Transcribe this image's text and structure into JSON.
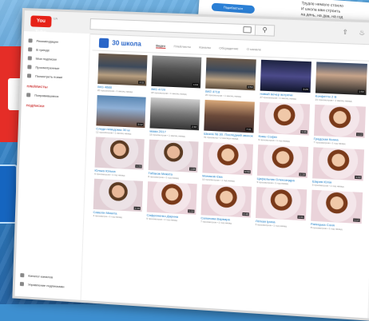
{
  "background_card": {
    "button_label": "Подобається",
    "text_lines": [
      "Трудов немало стоило",
      "И школа вам строить",
      "на день, на два, на год"
    ]
  },
  "colors": {
    "accent": "#e62117",
    "channel": "#2a66c8",
    "link": "#167ac6"
  },
  "topbar": {
    "logo_label": "You Tube",
    "country_code": "UA"
  },
  "sidebar": {
    "items": [
      {
        "icon": "home-icon",
        "label": "Рекомендации"
      },
      {
        "icon": "fire-icon",
        "label": "В тренде"
      },
      {
        "icon": "subscriptions-icon",
        "label": "Мои подписки"
      },
      {
        "icon": "history-icon",
        "label": "Просмотренные"
      },
      {
        "icon": "watch-later-icon",
        "label": "Посмотреть позже"
      }
    ],
    "section1_heading": "ПЛЕЙЛИСТЫ",
    "section1_items": [
      {
        "icon": "playlist-icon",
        "label": "Понравившиеся"
      }
    ],
    "section2_heading": "ПОДПИСКИ",
    "bottom_items": [
      {
        "icon": "catalog-icon",
        "label": "Каталог каналов"
      },
      {
        "icon": "manage-icon",
        "label": "Управление подписками"
      }
    ]
  },
  "channel": {
    "name": "30 школа",
    "tabs": [
      "Видео",
      "Плейлисты",
      "Каналы",
      "Обсуждение",
      "О канале"
    ],
    "active_tab": 0
  },
  "videos": [
    [
      {
        "thumb": "t-class",
        "title": "IMG 4688",
        "meta": "20 просмотров • 1 месяц назад",
        "duration": "2:11"
      },
      {
        "thumb": "t-dance",
        "title": "IMG 4720",
        "meta": "18 просмотров • 1 месяц назад",
        "duration": "1:04"
      },
      {
        "thumb": "t-class",
        "title": "IMG 4718",
        "meta": "20 просмотров • 1 месяц назад",
        "duration": "0:53"
      },
      {
        "thumb": "t-stage",
        "title": "новый вечер встречи",
        "meta": "27 просмотров • 1 месяц назад",
        "duration": "3:20"
      },
      {
        "thumb": "t-boy",
        "title": "Конфетти 2 В",
        "meta": "21 просмотров • 1 месяц назад",
        "duration": "1:59"
      }
    ],
    [
      {
        "thumb": "t-blue",
        "title": "Следи неведомы 30 ш",
        "meta": "12 просмотров • 1 месяц назад",
        "duration": "3:12"
      },
      {
        "thumb": "t-bw",
        "title": "мама 2017",
        "meta": "15 просмотров • 1 месяц назад",
        "duration": "2:40"
      },
      {
        "thumb": "t-warm",
        "title": "Школа № 30. Последний звонок 2016",
        "meta": "41 просмотр • 2 месяца назад",
        "duration": "7:31"
      },
      {
        "thumb": "t-girl",
        "title": "Кокш Софія",
        "meta": "9 просмотров • 1 год назад",
        "duration": "1:05"
      },
      {
        "thumb": "t-girl",
        "title": "Градская Ксана",
        "meta": "7 просмотров • 1 год назад",
        "duration": "1:12"
      }
    ],
    [
      {
        "thumb": "t-boy2",
        "title": "Юлька Юлька",
        "meta": "6 просмотров • 1 год назад",
        "duration": "1:20"
      },
      {
        "thumb": "t-boy2",
        "title": "Табаков Микита",
        "meta": "8 просмотров • 1 год назад",
        "duration": "1:08"
      },
      {
        "thumb": "t-girl",
        "title": "Монаков Єва",
        "meta": "10 просмотров • 1 год назад",
        "duration": "0:59"
      },
      {
        "thumb": "t-girl",
        "title": "Цифельник Олександра",
        "meta": "9 просмотров • 1 год назад",
        "duration": "1:15"
      },
      {
        "thumb": "t-girl",
        "title": "Шария Юлія",
        "meta": "5 просмотров • 1 год назад",
        "duration": "1:02"
      }
    ],
    [
      {
        "thumb": "t-boy2",
        "title": "Савелін Микита",
        "meta": "4 просмотра • 1 год назад",
        "duration": "1:10"
      },
      {
        "thumb": "t-girl",
        "title": "Сафроненко Дарина",
        "meta": "6 просмотров • 1 год назад",
        "duration": "1:22"
      },
      {
        "thumb": "t-girl",
        "title": "Сапонова Варвара",
        "meta": "7 просмотров • 1 год назад",
        "duration": "0:48"
      },
      {
        "thumb": "t-girl",
        "title": "Легкая Ірина",
        "meta": "5 просмотров • 1 год назад",
        "duration": "1:01"
      },
      {
        "thumb": "t-girl",
        "title": "Рапицька Соня",
        "meta": "8 просмотров • 1 год назад",
        "duration": "1:17"
      }
    ]
  ]
}
